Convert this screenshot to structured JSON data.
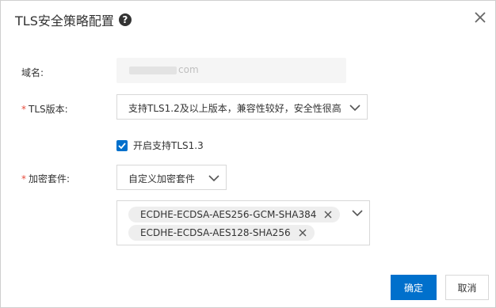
{
  "dialog": {
    "title": "TLS安全策略配置",
    "help_icon": "question-circle-icon",
    "close_icon": "close-icon"
  },
  "form": {
    "domain": {
      "label": "域名:",
      "value_suffix": "com"
    },
    "tls_version": {
      "required_mark": "*",
      "label": "TLS版本:",
      "selected": "支持TLS1.2及以上版本，兼容性较好，安全性很高"
    },
    "tls13": {
      "checked": true,
      "label": "开启支持TLS1.3"
    },
    "cipher_suite": {
      "required_mark": "*",
      "label": "加密套件:",
      "selected": "自定义加密套件",
      "tags": [
        "ECDHE-ECDSA-AES256-GCM-SHA384",
        "ECDHE-ECDSA-AES128-SHA256"
      ]
    }
  },
  "footer": {
    "confirm": "确定",
    "cancel": "取消"
  },
  "colors": {
    "primary": "#0070cc",
    "required": "#e74c3c",
    "border": "#d8d8d8"
  }
}
